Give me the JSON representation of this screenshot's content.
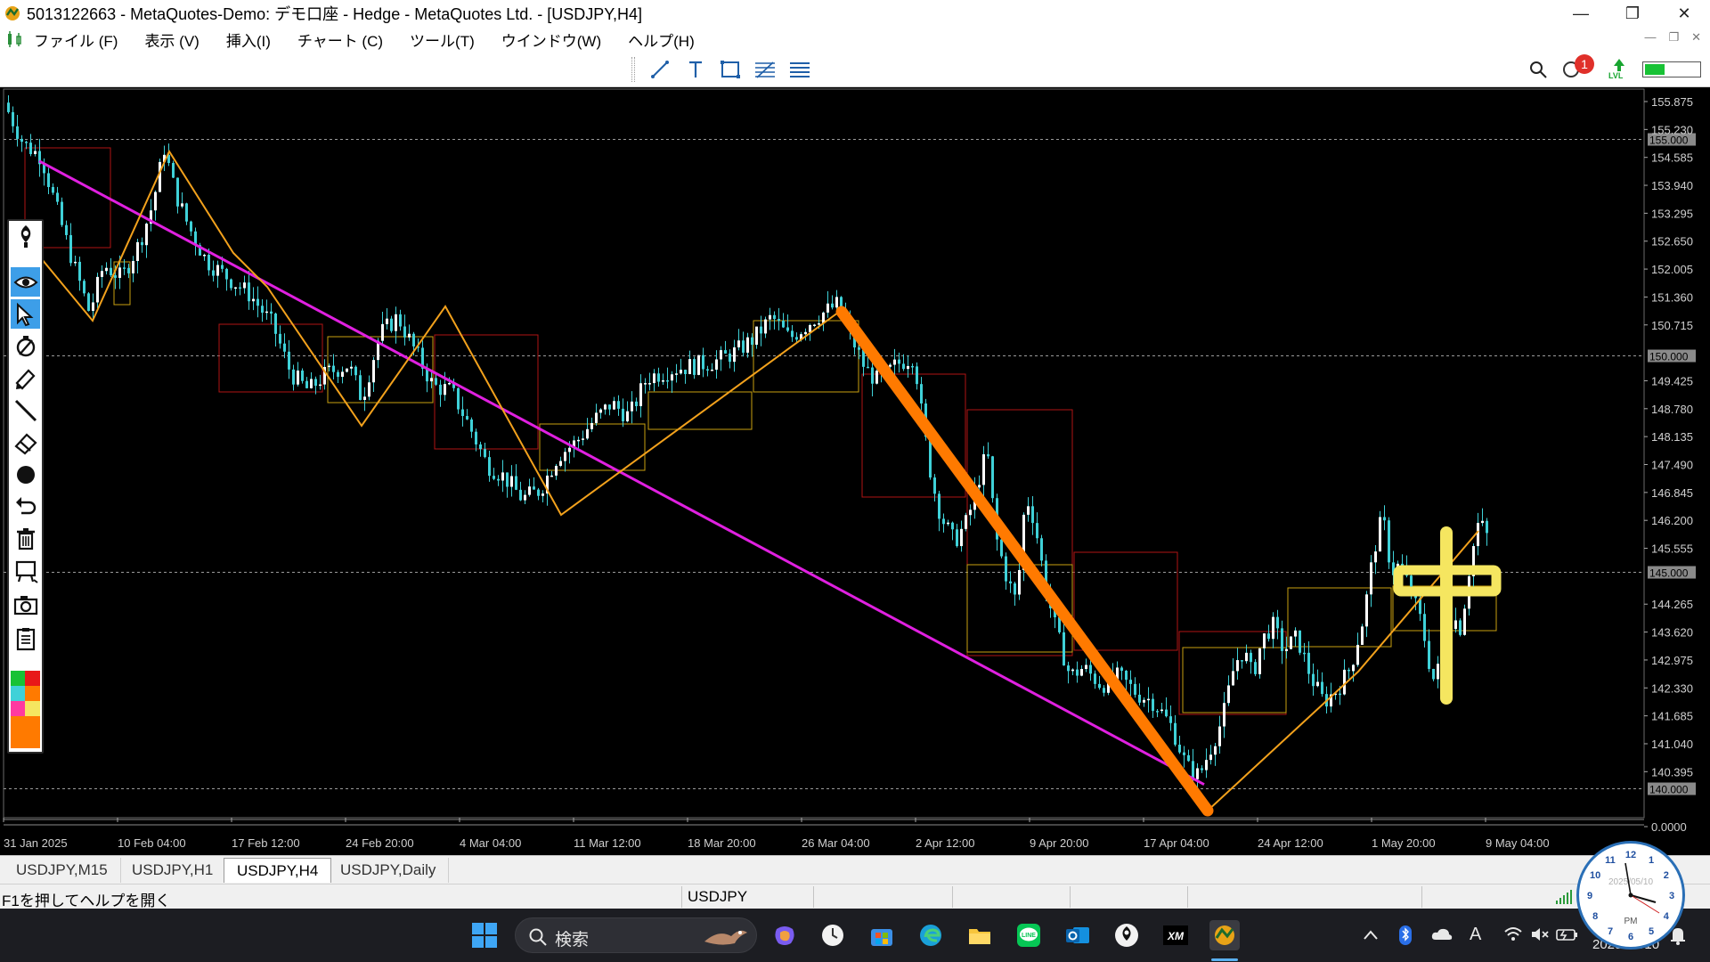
{
  "window": {
    "title": "5013122663 - MetaQuotes-Demo: デモ口座 - Hedge - MetaQuotes Ltd. - [USDJPY,H4]",
    "minimize": "—",
    "restore": "❐",
    "close": "✕"
  },
  "menu": {
    "items": [
      "ファイル (F)",
      "表示 (V)",
      "挿入(I)",
      "チャート (C)",
      "ツール(T)",
      "ウインドウ(W)",
      "ヘルプ(H)"
    ],
    "mdi": [
      "—",
      "❐",
      "✕"
    ]
  },
  "toolbar": {
    "notification_count": "1",
    "lvl_label": "LVL",
    "level_fraction": 0.35,
    "level_color": "#18c235"
  },
  "chart": {
    "symbol": "USDJPY",
    "timeframe": "H4",
    "price_axis": {
      "ticks": [
        "155.875",
        "155.230",
        "154.585",
        "153.940",
        "153.295",
        "152.650",
        "152.005",
        "151.360",
        "150.715",
        "149.425",
        "148.780",
        "148.135",
        "147.490",
        "146.845",
        "146.200",
        "145.555",
        "144.265",
        "143.620",
        "142.975",
        "142.330",
        "141.685",
        "141.040",
        "140.395",
        "0.0000"
      ],
      "levels": [
        "155.000",
        "150.000",
        "145.000",
        "140.000"
      ]
    },
    "time_axis": [
      "31 Jan 2025",
      "10 Feb 04:00",
      "17 Feb 12:00",
      "24 Feb 20:00",
      "4 Mar 04:00",
      "11 Mar 12:00",
      "18 Mar 20:00",
      "26 Mar 04:00",
      "2 Apr 12:00",
      "9 Apr 20:00",
      "17 Apr 04:00",
      "24 Apr 12:00",
      "1 May 20:00",
      "9 May 04:00"
    ],
    "colors": {
      "background": "#000000",
      "candle": "#3fd1d8",
      "zigzag": "#f2a11c",
      "trendline": "#e020e0",
      "thick_line": "#ff7a00",
      "box_red": "#b01515",
      "box_yellow": "#c8a010",
      "cross": "#f5e660"
    }
  },
  "toolpanel": {
    "swatches": [
      "#e81818",
      "#18c235",
      "#3fd1d8",
      "#f5e660",
      "#ff3aa0",
      "#ff7a00"
    ]
  },
  "tabs": [
    {
      "label": "USDJPY,M15",
      "active": false
    },
    {
      "label": "USDJPY,H1",
      "active": false
    },
    {
      "label": "USDJPY,H4",
      "active": true
    },
    {
      "label": "USDJPY,Daily",
      "active": false
    }
  ],
  "status": {
    "help_text": "F1を押してヘルプを開く",
    "symbol": "USDJPY"
  },
  "taskbar": {
    "search_placeholder": "検索",
    "date_fragment": "2025/05/10",
    "ime_letter": "A",
    "clock_date": "2025/05/10",
    "clock_pm": "PM"
  }
}
